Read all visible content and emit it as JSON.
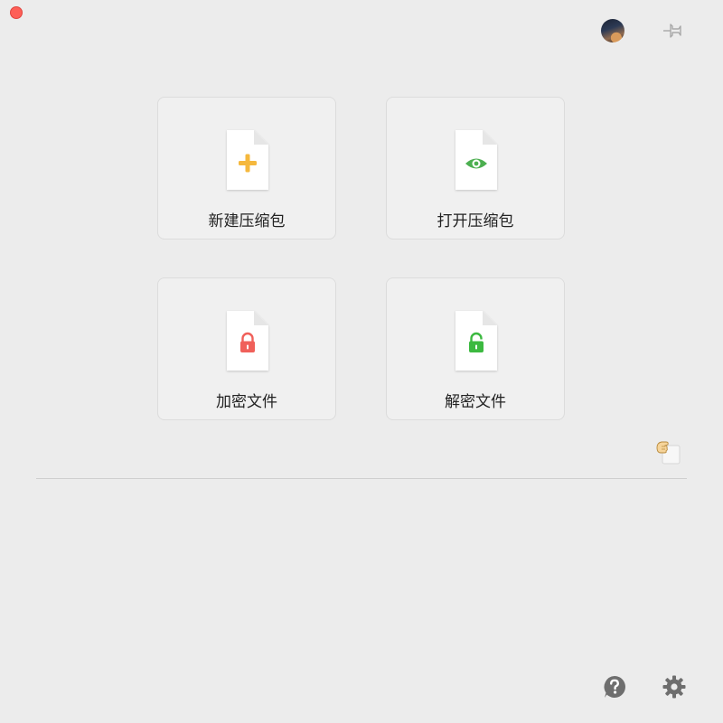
{
  "window": {
    "close_color": "#fe5f57"
  },
  "toolbar": {
    "avatar_icon": "avatar-icon",
    "pin_icon": "pin-icon"
  },
  "actions": [
    {
      "id": "new-archive",
      "label": "新建压缩包",
      "icon": "plus-icon",
      "color": "#f5b83d"
    },
    {
      "id": "open-archive",
      "label": "打开压缩包",
      "icon": "eye-icon",
      "color": "#4caf50"
    },
    {
      "id": "encrypt-file",
      "label": "加密文件",
      "icon": "lock-closed-icon",
      "color": "#f0605a"
    },
    {
      "id": "decrypt-file",
      "label": "解密文件",
      "icon": "lock-open-icon",
      "color": "#3cb940"
    }
  ],
  "drop_hint_icon": "hand-icon",
  "footer": {
    "help_icon": "help-icon",
    "settings_icon": "gear-icon"
  }
}
